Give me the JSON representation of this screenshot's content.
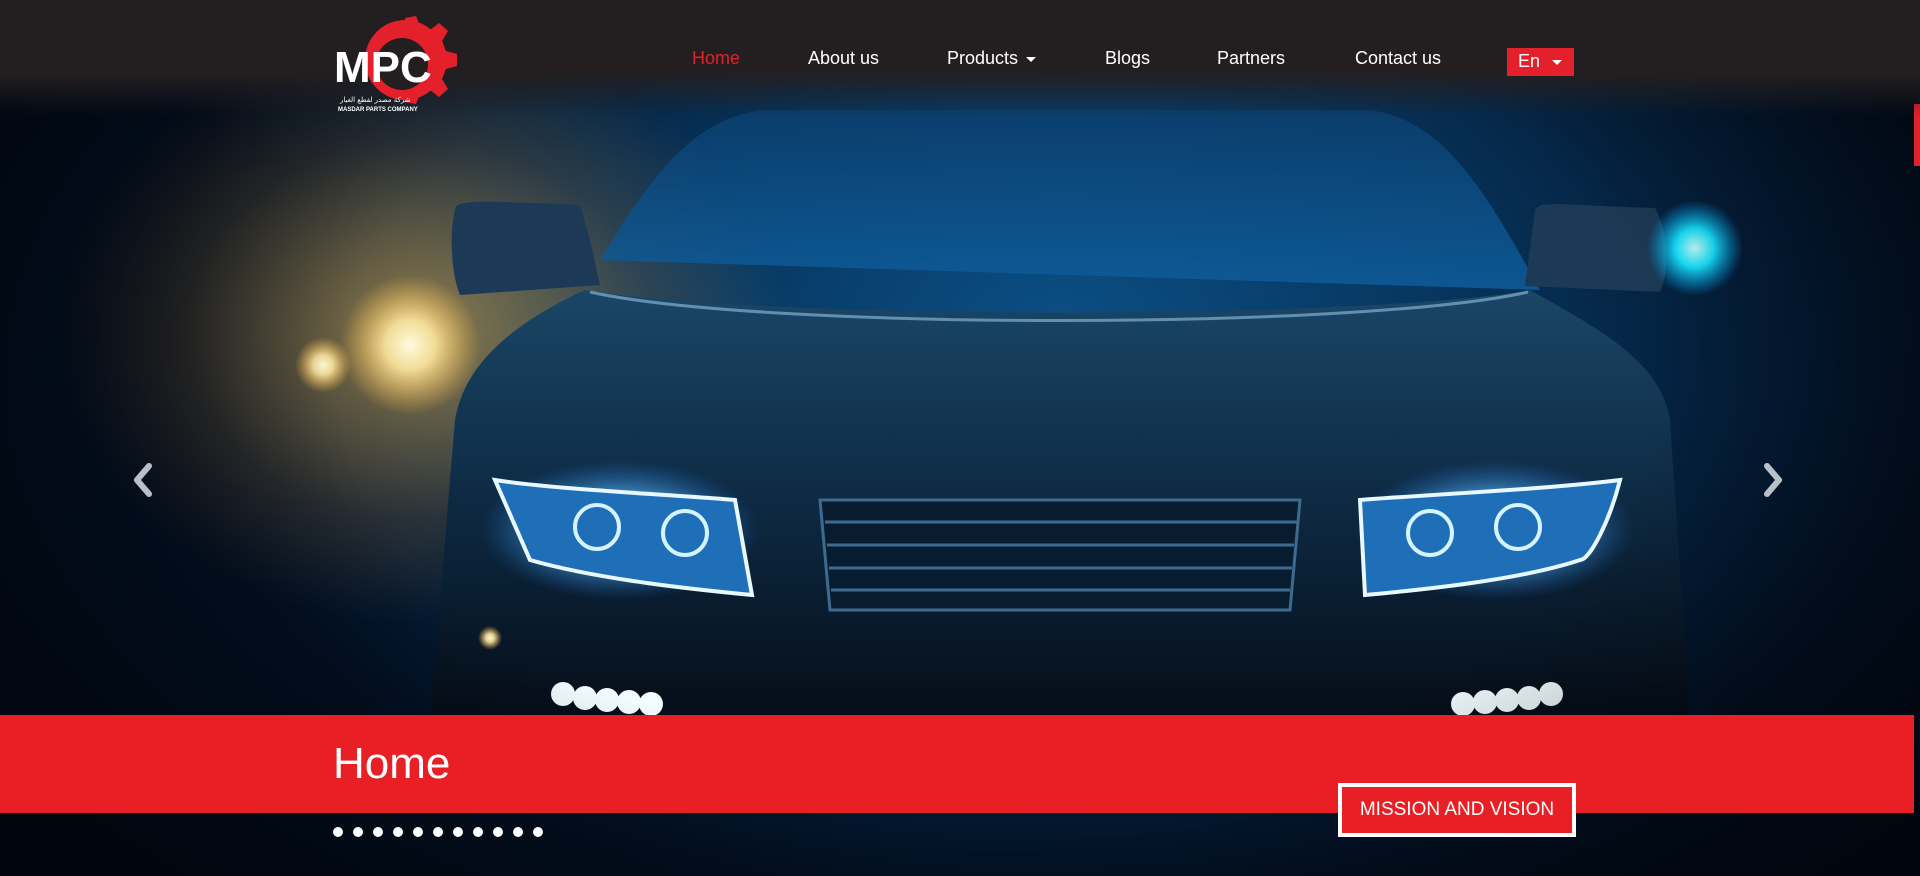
{
  "brand": {
    "logo_text": "MPC",
    "logo_arabic": "شركة مصدر لقطع الغيار",
    "logo_subtitle": "MASDAR PARTS COMPANY",
    "accent_color": "#e4202a",
    "header_color": "#231f20"
  },
  "nav": {
    "items": [
      {
        "label": "Home",
        "active": true
      },
      {
        "label": "About us",
        "active": false
      },
      {
        "label": "Products",
        "active": false,
        "dropdown": true
      },
      {
        "label": "Blogs",
        "active": false
      },
      {
        "label": "Partners",
        "active": false
      },
      {
        "label": "Contact us",
        "active": false
      }
    ],
    "language": "En"
  },
  "hero": {
    "prev_icon": "chevron-left-icon",
    "next_icon": "chevron-right-icon",
    "slide_count": 11,
    "active_slide": 1
  },
  "banner": {
    "title": "Home",
    "button_label": "MISSION AND VISION"
  }
}
